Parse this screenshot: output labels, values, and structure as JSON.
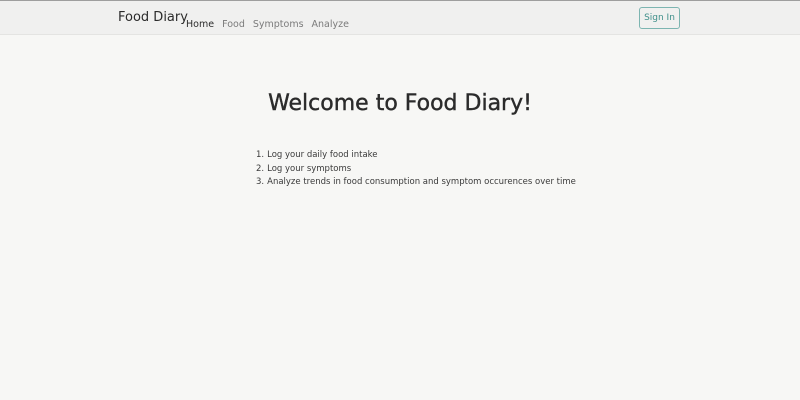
{
  "navbar": {
    "brand": "Food Diary",
    "links": [
      {
        "label": "Home",
        "active": true
      },
      {
        "label": "Food",
        "active": false
      },
      {
        "label": "Symptoms",
        "active": false
      },
      {
        "label": "Analyze",
        "active": false
      }
    ],
    "sign_in_label": "Sign In"
  },
  "main": {
    "title": "Welcome to Food Diary!",
    "steps": [
      {
        "number": "1.",
        "text": "Log your daily food intake"
      },
      {
        "number": "2.",
        "text": "Log your symptoms"
      },
      {
        "number": "3.",
        "text": "Analyze trends in food consumption and symptom occurences over time"
      }
    ]
  },
  "colors": {
    "background": "#f7f7f5",
    "navbar": "#f0f0ef",
    "accent": "#3f8f8a",
    "text": "#2b2b2b",
    "muted_text": "#7b7b7b"
  }
}
